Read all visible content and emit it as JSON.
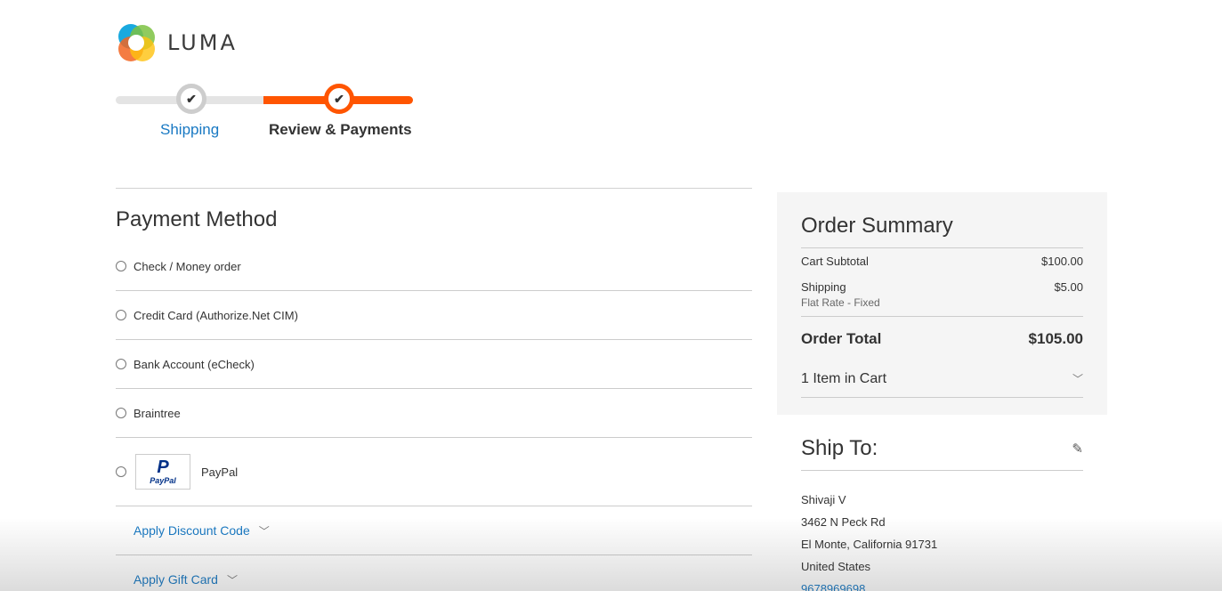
{
  "brand": {
    "name": "LUMA"
  },
  "progress": {
    "steps": [
      {
        "label": "Shipping",
        "state": "complete"
      },
      {
        "label": "Review & Payments",
        "state": "active"
      }
    ],
    "check_glyph": "✔"
  },
  "payment": {
    "title": "Payment Method",
    "methods": [
      {
        "label": "Check / Money order",
        "selected": false
      },
      {
        "label": "Credit Card (Authorize.Net CIM)",
        "selected": false
      },
      {
        "label": "Bank Account (eCheck)",
        "selected": false
      },
      {
        "label": "Braintree",
        "selected": false
      },
      {
        "label": "PayPal",
        "selected": false,
        "logo_text": "PayPal"
      }
    ],
    "discount_label": "Apply Discount Code",
    "gift_card_label": "Apply Gift Card"
  },
  "summary": {
    "title": "Order Summary",
    "subtotal_label": "Cart Subtotal",
    "subtotal_value": "$100.00",
    "shipping_label": "Shipping",
    "shipping_value": "$5.00",
    "shipping_method": "Flat Rate - Fixed",
    "total_label": "Order Total",
    "total_value": "$105.00",
    "items_in_cart": "1 Item in Cart"
  },
  "ship_to": {
    "title": "Ship To:",
    "name": "Shivaji V",
    "street": "3462 N Peck Rd",
    "city_line": "El Monte, California 91731",
    "country": "United States",
    "phone": "9678969698"
  },
  "colors": {
    "accent_orange": "#ff5501",
    "link_blue": "#1979c3",
    "summary_bg": "#f5f5f5"
  },
  "icons": {
    "logo": "luma-logo-icon",
    "check": "check-icon",
    "chevron": "chevron-down-icon",
    "edit": "pencil-icon"
  }
}
